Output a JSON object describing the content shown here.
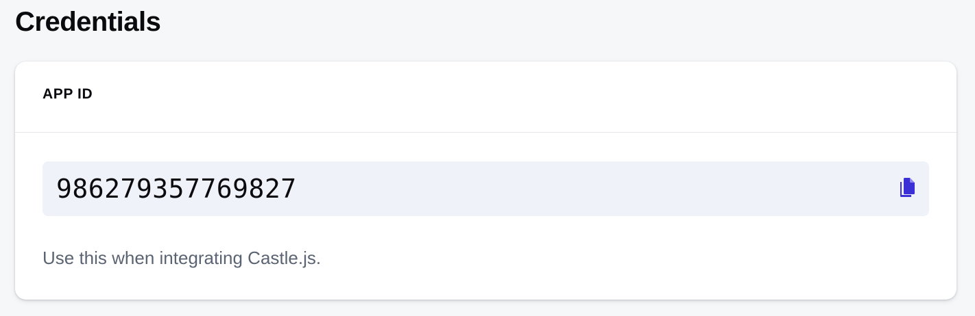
{
  "page": {
    "title": "Credentials"
  },
  "card": {
    "header_label": "APP ID",
    "app_id_value": "986279357769827",
    "copy_icon": "copy-icon",
    "helper_text": "Use this when integrating Castle.js."
  },
  "colors": {
    "accent": "#3b2fd6",
    "field_background": "#eff2f9",
    "page_background": "#f6f7f9",
    "helper_text": "#5b6472"
  }
}
